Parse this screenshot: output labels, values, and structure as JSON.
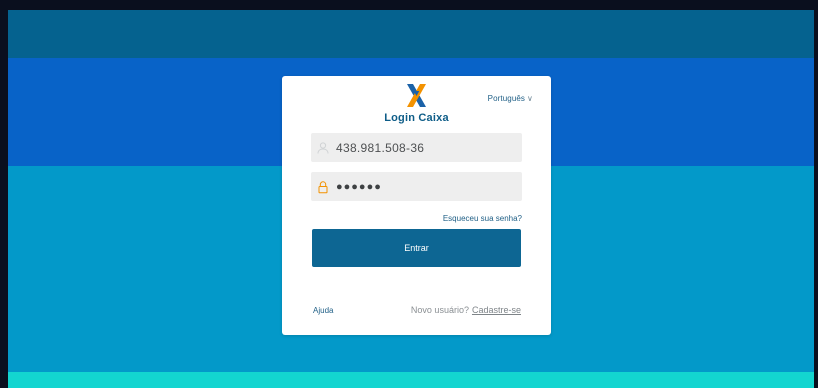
{
  "login": {
    "language_label": "Português",
    "title": "Login Caixa",
    "username_value": "438.981.508-36",
    "password_masked": "●●●●●●",
    "forgot_link": "Esqueceu sua senha?",
    "submit_label": "Entrar",
    "help_link": "Ajuda",
    "new_user_text": "Novo usuário?",
    "signup_link": "Cadastre-se"
  },
  "icons": {
    "logo": "caixa-x-logo",
    "language_chevron": "chevron-down-icon",
    "username": "user-icon",
    "password": "lock-icon"
  },
  "colors": {
    "top_band": "#05628f",
    "blue_band": "#0863c8",
    "cyan_band": "#0399c9",
    "teal_band": "#13d5d0",
    "accent": "#0d6693",
    "logo_blue": "#1b62a8",
    "logo_orange": "#f39200"
  }
}
